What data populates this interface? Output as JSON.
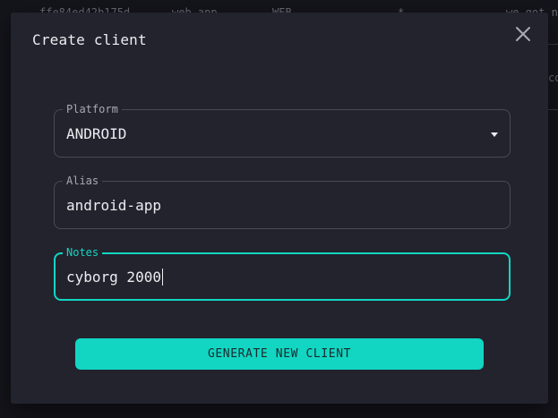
{
  "background": {
    "row": [
      "ffe84ed42b175d",
      "web-app",
      "WEB",
      "*",
      "we got n"
    ],
    "side_text": "co"
  },
  "dialog": {
    "title": "Create client",
    "close_icon": "close-icon",
    "platform": {
      "label": "Platform",
      "value": "ANDROID",
      "icon": "dropdown-arrow-icon"
    },
    "alias": {
      "label": "Alias",
      "value": "android-app"
    },
    "notes": {
      "label": "Notes",
      "value": "cyborg 2000"
    },
    "submit_label": "GENERATE NEW CLIENT"
  },
  "colors": {
    "accent": "#12d6c2",
    "dialog_bg": "#23232e",
    "page_bg": "#14141b",
    "text": "#ececf0",
    "border": "#4a4a56"
  }
}
